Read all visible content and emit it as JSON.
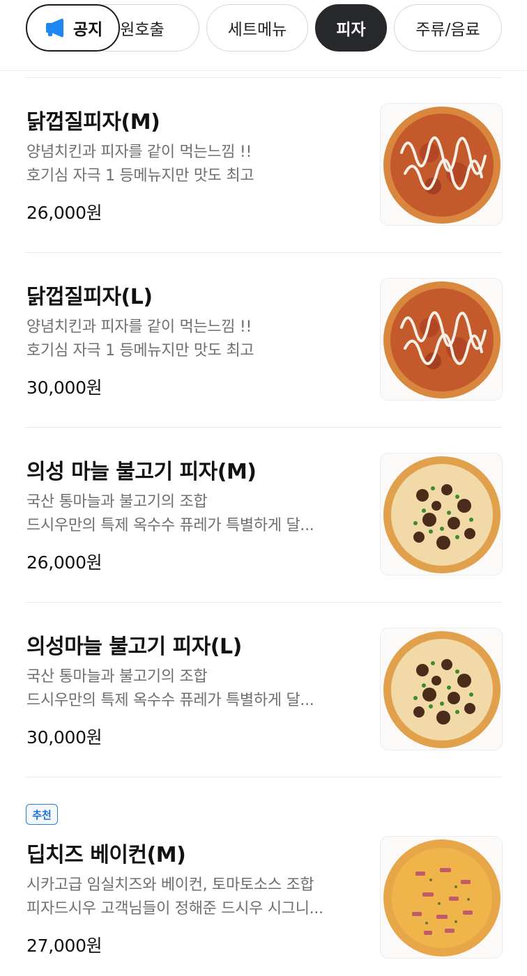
{
  "header": {
    "notice_label": "공지",
    "categories": [
      {
        "label": "직원호출"
      },
      {
        "label": "세트메뉴"
      },
      {
        "label": "피자"
      },
      {
        "label": "주류/음료"
      }
    ],
    "active_category": "피자"
  },
  "menu_items": [
    {
      "name": "닭껍질피자(M)",
      "desc1": "양념치킨과 피자를 같이 먹는느낌 !!",
      "desc2": "호기심 자극 1 등메뉴지만 맛도 최고",
      "price": "26,000원",
      "thumb_icon": "pizza-chicken-skin"
    },
    {
      "name": "닭껍질피자(L)",
      "desc1": "양념치킨과 피자를 같이 먹는느낌 !!",
      "desc2": "호기심 자극 1 등메뉴지만 맛도 최고",
      "price": "30,000원",
      "thumb_icon": "pizza-chicken-skin"
    },
    {
      "name": "의성 마늘 불고기 피자(M)",
      "desc1": "국산 통마늘과 불고기의 조합",
      "desc2": "드시우만의 특제 옥수수 퓨레가 특별하게 달...",
      "price": "26,000원",
      "thumb_icon": "pizza-bulgogi"
    },
    {
      "name": "의성마늘 불고기 피자(L)",
      "desc1": "국산 통마늘과 불고기의 조합",
      "desc2": "드시우만의 특제 옥수수 퓨레가 특별하게 달...",
      "price": "30,000원",
      "thumb_icon": "pizza-bulgogi"
    },
    {
      "badge": "추천",
      "name": "딥치즈 베이컨(M)",
      "desc1": "시카고급 임실치즈와 베이컨, 토마토소스 조합",
      "desc2": "피자드시우 고객님들이 정해준 드시우 시그니...",
      "price": "27,000원",
      "thumb_icon": "pizza-bacon"
    }
  ],
  "colors": {
    "active_chip": "#26282b",
    "badge": "#2f7ed8",
    "notice_icon": "#1e88f0"
  }
}
